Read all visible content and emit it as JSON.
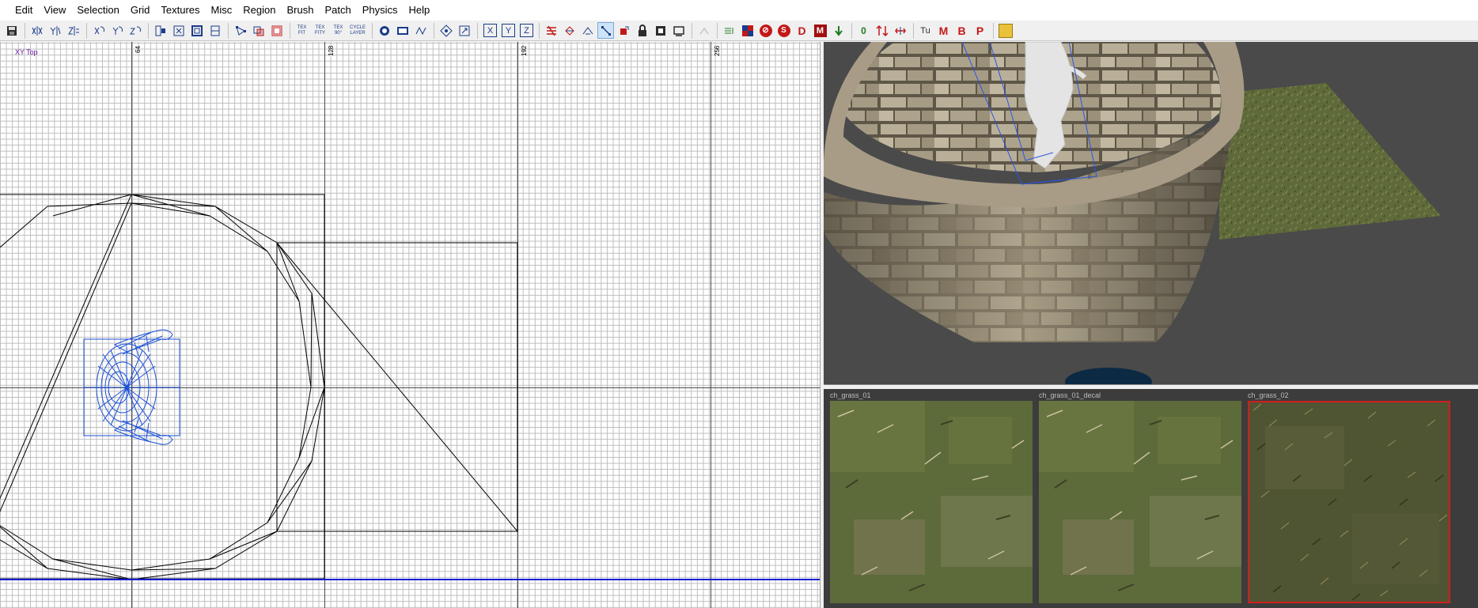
{
  "menu": {
    "items": [
      "Edit",
      "View",
      "Selection",
      "Grid",
      "Textures",
      "Misc",
      "Region",
      "Brush",
      "Patch",
      "Physics",
      "Help"
    ]
  },
  "toolbar": {
    "tex_fit_label": "TEX FIT",
    "tex_fit_y_label": "TEX FITY",
    "tex_90_label": "TEX 90°",
    "cycle_layer_label": "CYCLE LAYER",
    "axis_x_label": "X",
    "axis_y_label": "Y",
    "axis_z_label": "Z",
    "d_label": "D",
    "m_label": "M",
    "zero_label": "0",
    "tu_label": "Tu",
    "m2_label": "M",
    "b_label": "B",
    "p_label": "P",
    "s_label": "S"
  },
  "grid_view": {
    "view_label": "XY Top",
    "ruler_labels": [
      "64",
      "128",
      "192",
      "256"
    ]
  },
  "textures": [
    {
      "name": "ch_grass_01",
      "selected": false
    },
    {
      "name": "ch_grass_01_decal",
      "selected": false
    },
    {
      "name": "ch_grass_02",
      "selected": true
    }
  ],
  "colors": {
    "selection": "#1a4fd6",
    "brush_wire": "#000000",
    "texture_selected_border": "#d01e1e",
    "view_label": "#6a1aa0"
  }
}
